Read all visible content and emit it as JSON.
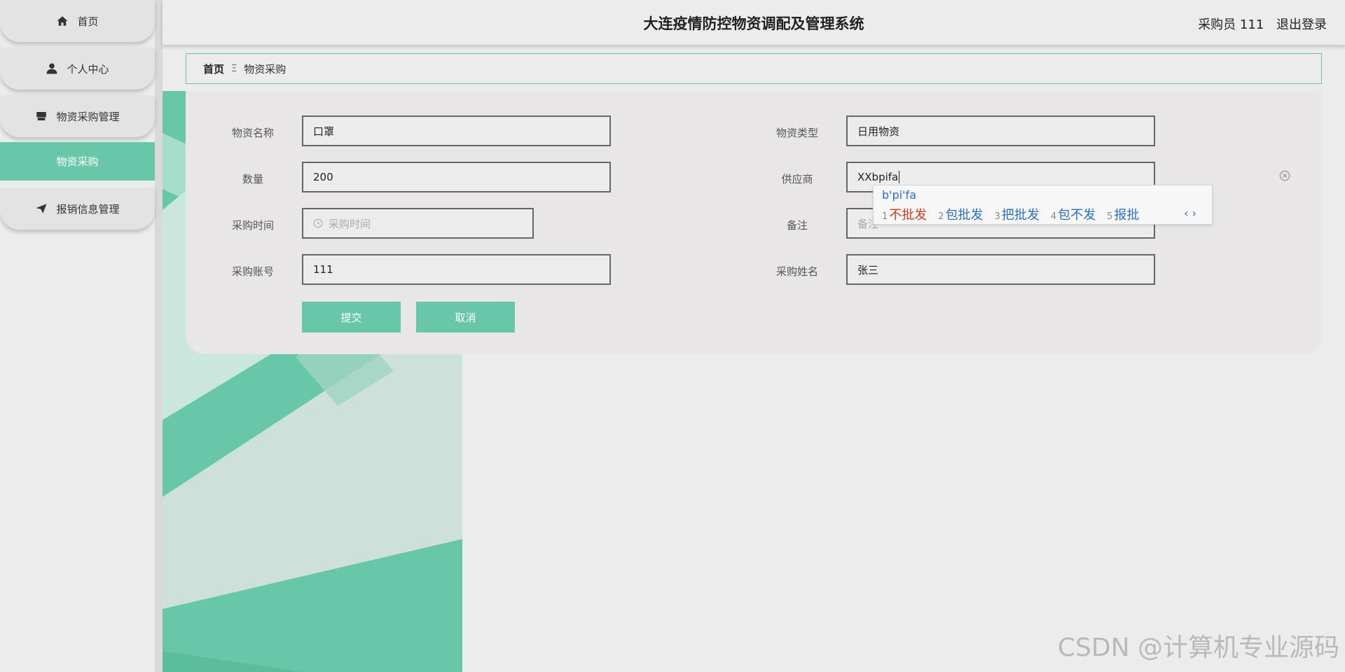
{
  "sidebar": {
    "items": [
      {
        "label": "首页",
        "icon": "home-icon"
      },
      {
        "label": "个人中心",
        "icon": "user-icon"
      },
      {
        "label": "物资采购管理",
        "icon": "store-icon"
      },
      {
        "label": "物资采购",
        "icon": ""
      },
      {
        "label": "报销信息管理",
        "icon": "send-icon"
      }
    ]
  },
  "header": {
    "title": "大连疫情防控物资调配及管理系统",
    "user_role": "采购员 111",
    "logout": "退出登录"
  },
  "breadcrumb": {
    "home": "首页",
    "separator": "Ξ",
    "current": "物资采购"
  },
  "form": {
    "name_label": "物资名称",
    "name_value": "口罩",
    "type_label": "物资类型",
    "type_value": "日用物资",
    "qty_label": "数量",
    "qty_value": "200",
    "supplier_label": "供应商",
    "supplier_value": "XXbpifa",
    "time_label": "采购时间",
    "time_placeholder": "采购时间",
    "remark_label": "备注",
    "remark_placeholder": "备注",
    "account_label": "采购账号",
    "account_value": "111",
    "buyer_label": "采购姓名",
    "buyer_value": "张三",
    "submit": "提交",
    "cancel": "取消"
  },
  "ime": {
    "pinyin": "b'pi'fa",
    "candidates": [
      {
        "num": "1",
        "text": "不批发"
      },
      {
        "num": "2",
        "text": "包批发"
      },
      {
        "num": "3",
        "text": "把批发"
      },
      {
        "num": "4",
        "text": "包不发"
      },
      {
        "num": "5",
        "text": "报批"
      }
    ],
    "nav": "‹ ›"
  },
  "watermark": "CSDN @计算机专业源码",
  "colors": {
    "accent": "#68c7a8",
    "background": "#ececec"
  }
}
